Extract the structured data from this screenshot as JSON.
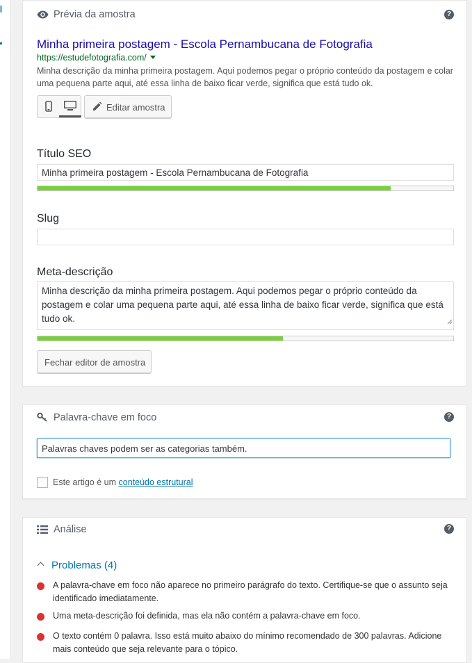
{
  "preview_panel": {
    "title": "Prévia da amostra",
    "help": "?",
    "serp": {
      "title": "Minha primeira postagem - Escola Pernambucana de Fotografia",
      "url": "https://estudefotografia.com/",
      "description": "Minha descrição da minha primeira postagem. Aqui podemos pegar o próprio conteúdo da postagem e colar uma pequena parte aqui, até essa linha de baixo ficar verde, significa que está tudo ok."
    },
    "edit_button": "Editar amostra",
    "seo_title": {
      "label": "Título SEO",
      "value": "Minha primeira postagem - Escola Pernambucana de Fotografia",
      "progress": 0.85
    },
    "slug": {
      "label": "Slug",
      "value": ""
    },
    "meta": {
      "label": "Meta-descrição",
      "value": "Minha descrição da minha primeira postagem. Aqui podemos pegar o próprio conteúdo da postagem e colar uma pequena parte aqui, até essa linha de baixo ficar verde, significa que está tudo ok.",
      "progress": 0.59
    },
    "close_button": "Fechar editor de amostra"
  },
  "keyword_panel": {
    "title": "Palavra-chave em foco",
    "help": "?",
    "value": "Palavras chaves podem ser as categorias também.",
    "cornerstone_text": "Este artigo é um",
    "cornerstone_link": "conteúdo estrutural"
  },
  "analysis_panel": {
    "title": "Análise",
    "help": "?",
    "problems_heading": "Problemas (4)",
    "problems": [
      "A palavra-chave em foco não aparece no primeiro parágrafo do texto. Certifique-se que o assunto seja identificado imediatamente.",
      "Uma meta-descrição foi definida, mas ela não contém a palavra-chave em foco.",
      "O texto contém 0 palavra. Isso está muito abaixo do mínimo recomendado de 300 palavras. Adicione mais conteúdo que seja relevante para o tópico."
    ]
  },
  "colors": {
    "good": "#7ad03a",
    "problem": "#dc3232",
    "link": "#0073aa",
    "serp_title": "#1a0dab",
    "serp_url": "#006621"
  }
}
